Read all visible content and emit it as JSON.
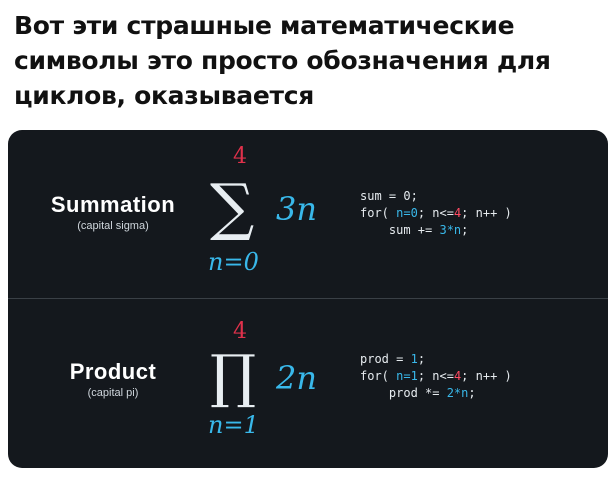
{
  "caption": "Вот эти страшные математические символы это просто обозначения для циклов, оказывается",
  "accent_colors": {
    "upper_bound": "#e0314b",
    "variable": "#39b8ea",
    "background": "#14181d"
  },
  "summation": {
    "title": "Summation",
    "subtitle": "(capital sigma)",
    "upper": "4",
    "symbol": "∑",
    "term": "3n",
    "lower": "n=0",
    "code": {
      "line1": "sum = 0;",
      "line2_a": "for( ",
      "line2_b": "n=0",
      "line2_c": "; n<=",
      "line2_d": "4",
      "line2_e": "; n++ )",
      "line3_a": "    sum += ",
      "line3_b": "3*n",
      "line3_c": ";"
    }
  },
  "product": {
    "title": "Product",
    "subtitle": "(capital pi)",
    "upper": "4",
    "symbol": "∏",
    "term": "2n",
    "lower": "n=1",
    "code": {
      "line1_a": "prod = ",
      "line1_b": "1",
      "line1_c": ";",
      "line2_a": "for( ",
      "line2_b": "n=1",
      "line2_c": "; n<=",
      "line2_d": "4",
      "line2_e": "; n++ )",
      "line3_a": "    prod *= ",
      "line3_b": "2*n",
      "line3_c": ";"
    }
  }
}
